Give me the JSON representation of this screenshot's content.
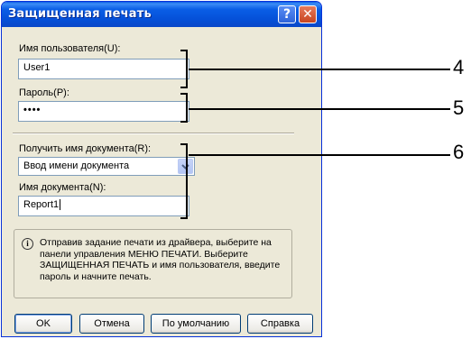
{
  "dialog": {
    "title": "Защищенная печать",
    "help_btn": "?",
    "close_btn": "✕"
  },
  "form": {
    "username_label": "Имя пользователя(U):",
    "username_value": "User1",
    "password_label": "Пароль(P):",
    "password_value": "••••",
    "get_doc_name_label": "Получить имя документа(R):",
    "get_doc_name_selected": "Ввод имени документа",
    "doc_name_label": "Имя документа(N):",
    "doc_name_value": "Report1"
  },
  "info": {
    "text": "Отправив задание печати из драйвера, выберите на панели управления МЕНЮ ПЕЧАТИ. Выберите ЗАЩИЩЕННАЯ ПЕЧАТЬ и имя пользователя, введите пароль и начните печать."
  },
  "buttons": {
    "ok": "OK",
    "cancel": "Отмена",
    "defaults": "По умолчанию",
    "help": "Справка"
  },
  "callouts": {
    "c4": "4",
    "c5": "5",
    "c6": "6"
  }
}
